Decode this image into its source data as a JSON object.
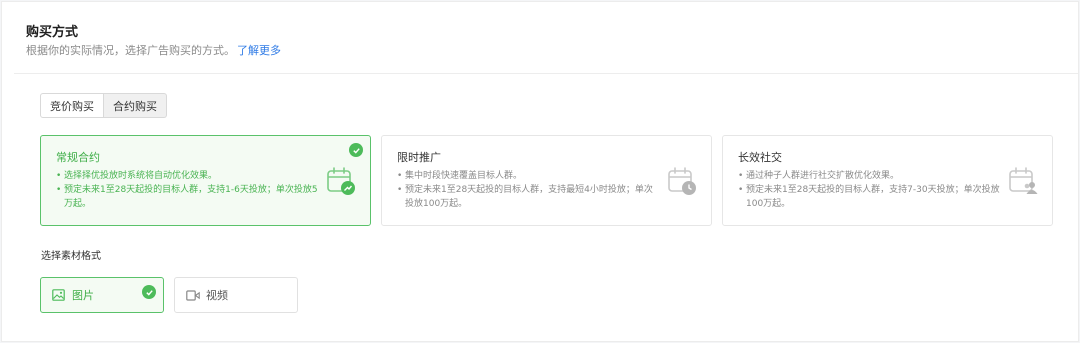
{
  "header": {
    "title": "购买方式",
    "subtitle": "根据你的实际情况，选择广告购买的方式。",
    "learn_more": "了解更多"
  },
  "buy_modes": [
    "竞价购买",
    "合约购买"
  ],
  "cards": [
    {
      "title": "常规合约",
      "lines": [
        "选择择优投放时系统将自动优化效果。",
        "预定未来1至28天起投的目标人群，支持1-6天投放；单次投放5万起。"
      ],
      "icon": "calendar-trend-icon",
      "selected": true
    },
    {
      "title": "限时推广",
      "lines": [
        "集中时段快速覆盖目标人群。",
        "预定未来1至28天起投的目标人群，支持最短4小时投放；单次投放100万起。"
      ],
      "icon": "calendar-clock-icon",
      "selected": false
    },
    {
      "title": "长效社交",
      "lines": [
        "通过种子人群进行社交扩散优化效果。",
        "预定未来1至28天起投的目标人群，支持7-30天投放；单次投放100万起。"
      ],
      "icon": "calendar-people-icon",
      "selected": false
    }
  ],
  "material": {
    "label": "选择素材格式",
    "options": [
      {
        "label": "图片",
        "icon": "image-icon",
        "selected": true
      },
      {
        "label": "视频",
        "icon": "video-icon",
        "selected": false
      }
    ]
  },
  "colors": {
    "accent_green": "#4dbb5a",
    "link_blue": "#2f7be6"
  }
}
